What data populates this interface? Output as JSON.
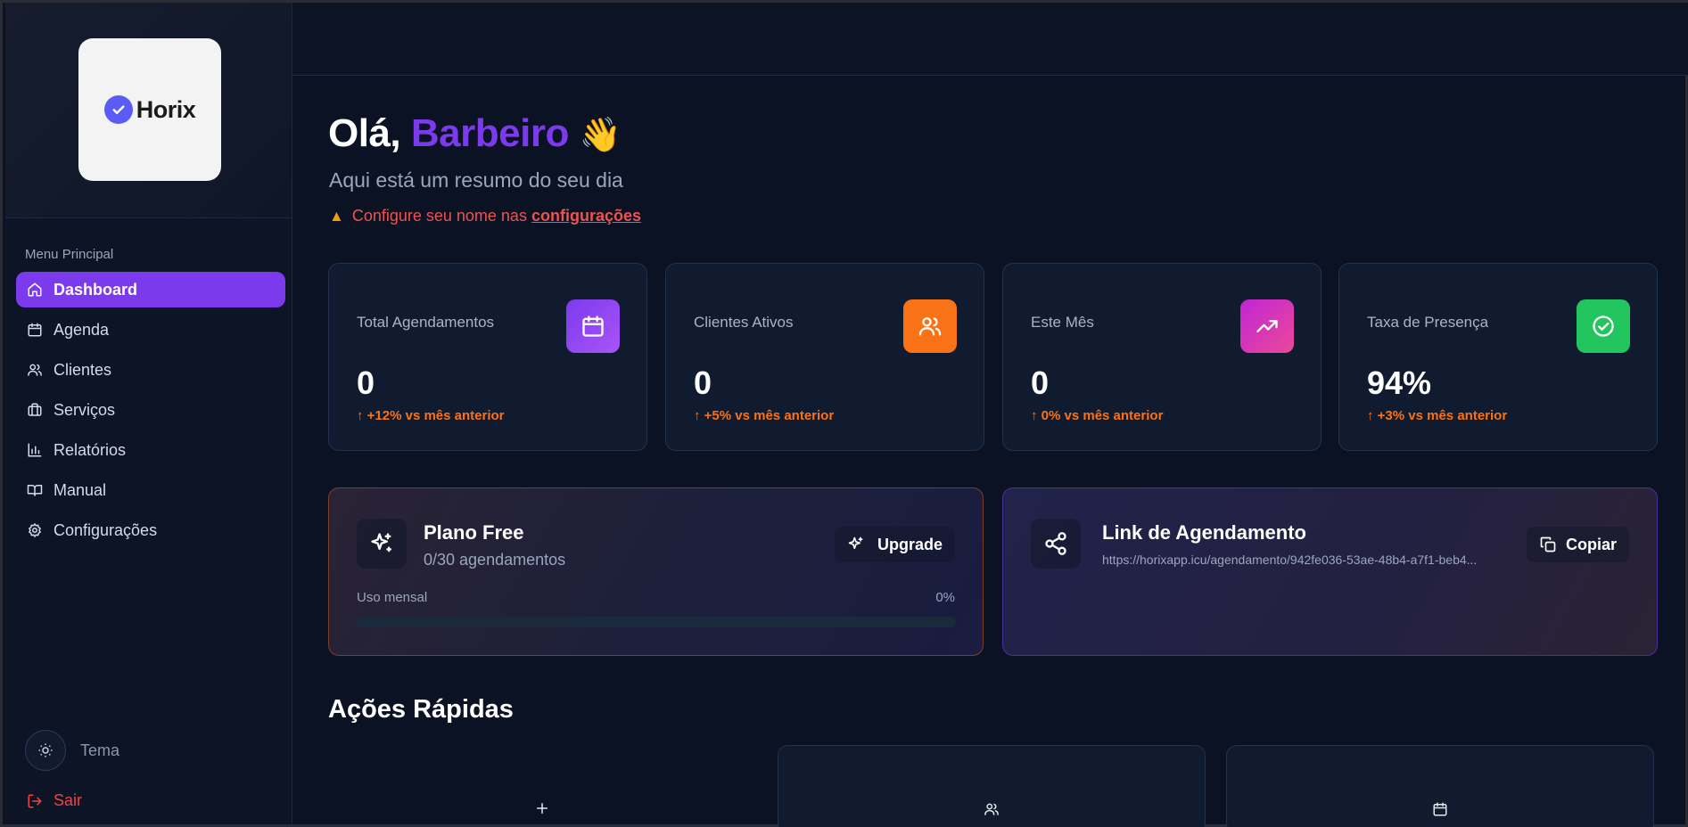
{
  "sidebar": {
    "logo_text": "Horix",
    "menu_title": "Menu Principal",
    "items": [
      {
        "label": "Dashboard",
        "icon": "home-icon",
        "active": true
      },
      {
        "label": "Agenda",
        "icon": "calendar-icon"
      },
      {
        "label": "Clientes",
        "icon": "users-icon"
      },
      {
        "label": "Serviços",
        "icon": "briefcase-icon"
      },
      {
        "label": "Relatórios",
        "icon": "bar-chart-icon"
      },
      {
        "label": "Manual",
        "icon": "book-icon"
      },
      {
        "label": "Configurações",
        "icon": "gear-icon"
      }
    ],
    "theme_label": "Tema",
    "logout_label": "Sair"
  },
  "header": {
    "greeting_prefix": "Olá, ",
    "greeting_name": "Barbeiro",
    "greeting_emoji": "👋",
    "subtitle": "Aqui está um resumo do seu dia",
    "warning_text": "Configure seu nome nas",
    "warning_link": "configurações"
  },
  "stats": [
    {
      "label": "Total Agendamentos",
      "value": "0",
      "trend": "↑ +12% vs mês anterior",
      "icon": "calendar-icon",
      "color": "#8b5cf6"
    },
    {
      "label": "Clientes Ativos",
      "value": "0",
      "trend": "↑ +5% vs mês anterior",
      "icon": "users-icon",
      "color": "#f97316"
    },
    {
      "label": "Este Mês",
      "value": "0",
      "trend": "↑ 0% vs mês anterior",
      "icon": "trending-up-icon",
      "color": "#d946ef"
    },
    {
      "label": "Taxa de Presença",
      "value": "94%",
      "trend": "↑ +3% vs mês anterior",
      "icon": "check-circle-icon",
      "color": "#22c55e"
    }
  ],
  "plan": {
    "title": "Plano Free",
    "subtitle": "0/30 agendamentos",
    "upgrade_label": "Upgrade",
    "usage_label": "Uso mensal",
    "usage_pct": "0%",
    "usage_fraction": 0
  },
  "link": {
    "title": "Link de Agendamento",
    "url": "https://horixapp.icu/agendamento/942fe036-53ae-48b4-a7f1-beb4...",
    "copy_label": "Copiar"
  },
  "quick_actions": {
    "title": "Ações Rápidas",
    "items": [
      {
        "icon": "plus-icon"
      },
      {
        "icon": "users-icon"
      },
      {
        "icon": "calendar-icon"
      }
    ]
  },
  "colors": {
    "accent": "#7c3aed",
    "background": "#0b1223",
    "warning": "#f0524f",
    "trend": "#f97316"
  }
}
